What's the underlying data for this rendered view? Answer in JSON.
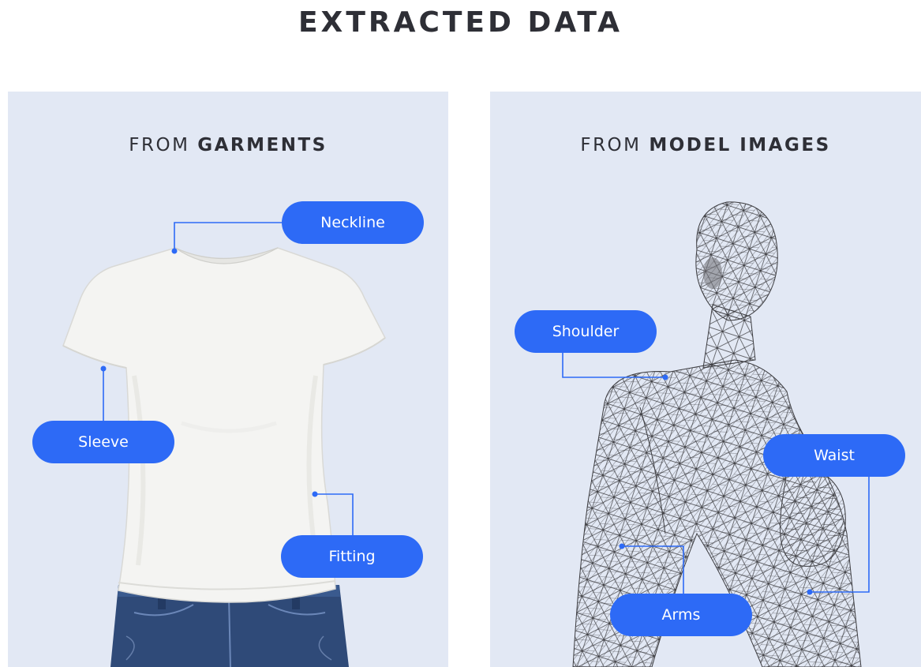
{
  "title": "EXTRACTED DATA",
  "panels": {
    "garments": {
      "heading_prefix": "FROM",
      "heading_bold": "GARMENTS",
      "labels": {
        "neckline": "Neckline",
        "sleeve": "Sleeve",
        "fitting": "Fitting"
      }
    },
    "model": {
      "heading_prefix": "FROM",
      "heading_bold": "MODEL IMAGES",
      "labels": {
        "shoulder": "Shoulder",
        "waist": "Waist",
        "arms": "Arms"
      }
    }
  },
  "colors": {
    "accent": "#2d6af6",
    "panel_bg": "#e2e8f4",
    "heading_text": "#2e2f36",
    "shirt": "#f4f4f2",
    "jeans": "#2f4a78"
  }
}
